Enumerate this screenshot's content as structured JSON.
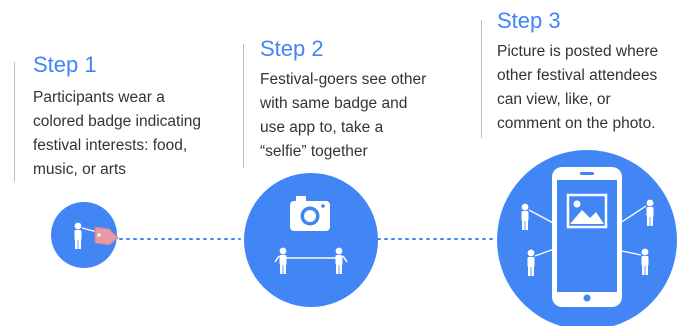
{
  "steps": [
    {
      "title": "Step 1",
      "lines": [
        "Participants wear a",
        "colored badge indicating",
        "festival interests: food,",
        "music, or arts"
      ]
    },
    {
      "title": "Step 2",
      "lines": [
        "Festival-goers see other",
        "with same badge and",
        "use app to, take a",
        "“selfie” together"
      ]
    },
    {
      "title": "Step 3",
      "lines": [
        "Picture is posted where",
        "other festival attendees",
        "can view, like, or",
        "comment on the photo."
      ]
    }
  ],
  "icons": [
    "person-with-badge-icon",
    "camera-selfie-icon",
    "phone-sharing-icon"
  ],
  "colors": {
    "accent": "#4285f4",
    "text": "#333333",
    "badge": "#e59aa6",
    "divider": "#bdbdbd"
  }
}
